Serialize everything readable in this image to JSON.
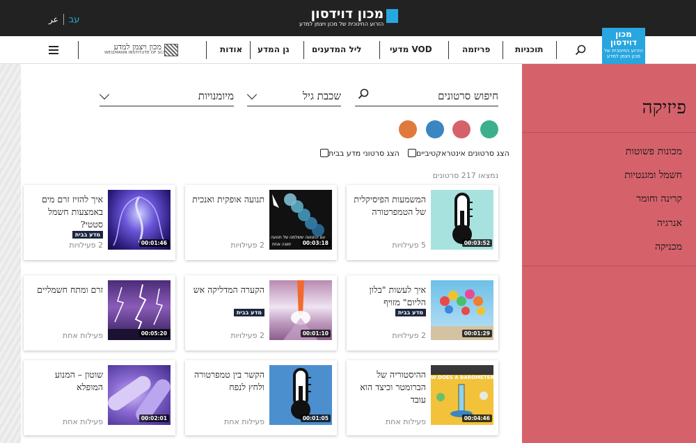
{
  "language": {
    "arabic": "عر",
    "hebrew": "עב"
  },
  "top_logo": {
    "title": "מכון דוידסון",
    "subtitle": "הזרוע החינוכית של מכון ויצמן למדע"
  },
  "corner_logo": {
    "line1": "מכון",
    "line2": "דוידסון",
    "tagline": "הזרוע החינוכית של מכון ויצמן למדע"
  },
  "weizmann": {
    "hebrew": "מכון ויצמן למדע",
    "english": "WEIZMANN INSTITUTE OF SCIENCE"
  },
  "nav": {
    "items": [
      "תוכניות",
      "פריזמה",
      "VOD מדעי",
      "ליל המדענים",
      "גן המדע",
      "אודות"
    ]
  },
  "sidebar": {
    "title": "פיזיקה",
    "categories": [
      "מכונות פשוטות",
      "חשמל ומגנטיות",
      "קרינה וחומר",
      "אנרגיה",
      "מכניקה"
    ]
  },
  "filters": {
    "search_label": "חיפוש סרטונים",
    "grade_label": "שכבת גיל",
    "skills_label": "מיומנויות"
  },
  "colors": [
    "#3cb08c",
    "#d5626b",
    "#3a86c1",
    "#e07a3c"
  ],
  "checkboxes": {
    "interactive": "הצג סרטונים אינטראקטיביים",
    "home_science": "הצג סרטוני מדע בבית"
  },
  "results_count": "נמצאו 217 סרטונים",
  "videos": [
    {
      "title": "המשמעות הפיסיקלית של הטמפרטורה",
      "duration": "00:03:52",
      "activities": "5 פעילויות",
      "badge": ""
    },
    {
      "title": "תנועה אופקית ואנכית",
      "duration": "00:03:18",
      "activities": "2 פעילויות",
      "badge": ""
    },
    {
      "title": "איך להזיז זרם מים באמצעות חשמל סטטי?",
      "duration": "00:01:46",
      "activities": "2 פעילויות",
      "badge": "מדע בבית"
    },
    {
      "title": "איך לעשות \"בלון הליום\" מזויף",
      "duration": "00:01:29",
      "activities": "2 פעילויות",
      "badge": "מדע בבית"
    },
    {
      "title": "הקערה המדליקה אש",
      "duration": "00:01:10",
      "activities": "2 פעילויות",
      "badge": "מדע בבית"
    },
    {
      "title": "זרם ומתח חשמליים",
      "duration": "00:05:20",
      "activities": "פעילות אחת",
      "badge": ""
    },
    {
      "title": "ההיסטוריה של הברומטר וכיצד הוא עובד",
      "duration": "00:04:46",
      "activities": "פעילות אחת",
      "badge": ""
    },
    {
      "title": "הקשר בין טמפרטורה ולחץ לנפח",
      "duration": "00:01:05",
      "activities": "פעילות אחת",
      "badge": ""
    },
    {
      "title": "שוטון – המנוע המופלא",
      "duration": "00:02:01",
      "activities": "פעילות אחת",
      "badge": ""
    }
  ],
  "thumb_text": {
    "motion_caption_1": "עם התנועה ששלמנו של תנועה",
    "motion_caption_2": "ימונה אחת",
    "barometer": "W DOES A BAROMETER WOR"
  }
}
